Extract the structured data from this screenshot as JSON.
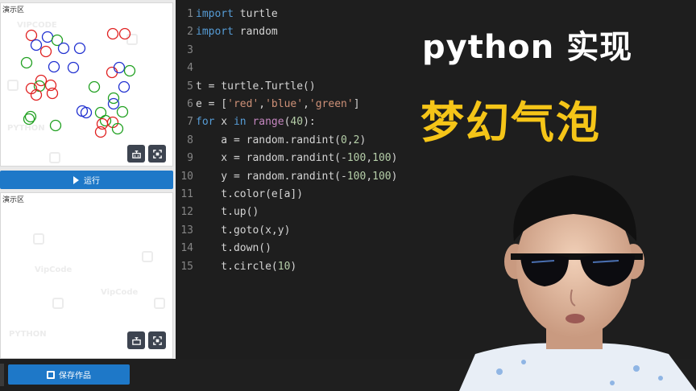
{
  "panels": {
    "top_title": "演示区",
    "bottom_title": "演示区",
    "watermarks": [
      "VIPCODE",
      "PYTHON",
      "VipCode",
      "VipCode",
      "PYTHON"
    ]
  },
  "run_button": {
    "label": "运行"
  },
  "save_button": {
    "label": "保存作品"
  },
  "overlay": {
    "title_line1": "python 实现",
    "title_line2": "梦幻气泡",
    "title1_color": "#ffffff",
    "title2_color": "#f5c518"
  },
  "editor": {
    "lines": [
      {
        "n": "1",
        "tokens": [
          [
            "kw",
            "import"
          ],
          [
            "t",
            " turtle"
          ]
        ]
      },
      {
        "n": "2",
        "tokens": [
          [
            "kw",
            "import"
          ],
          [
            "t",
            " random"
          ]
        ]
      },
      {
        "n": "3",
        "tokens": []
      },
      {
        "n": "4",
        "tokens": []
      },
      {
        "n": "5",
        "tokens": [
          [
            "t",
            "t = turtle.Turtle()"
          ]
        ]
      },
      {
        "n": "6",
        "tokens": [
          [
            "t",
            "e = ["
          ],
          [
            "str",
            "'red'"
          ],
          [
            "t",
            ","
          ],
          [
            "str",
            "'blue'"
          ],
          [
            "t",
            ","
          ],
          [
            "str",
            "'green'"
          ],
          [
            "t",
            "]"
          ]
        ]
      },
      {
        "n": "7",
        "tokens": [
          [
            "kw",
            "for"
          ],
          [
            "t",
            " x "
          ],
          [
            "kw",
            "in"
          ],
          [
            "t",
            " "
          ],
          [
            "bi",
            "range"
          ],
          [
            "t",
            "("
          ],
          [
            "num",
            "40"
          ],
          [
            "t",
            "):"
          ]
        ]
      },
      {
        "n": "8",
        "tokens": [
          [
            "t",
            "    a = random.randint("
          ],
          [
            "num",
            "0"
          ],
          [
            "t",
            ","
          ],
          [
            "num",
            "2"
          ],
          [
            "t",
            ")"
          ]
        ]
      },
      {
        "n": "9",
        "tokens": [
          [
            "t",
            "    x = random.randint(-"
          ],
          [
            "num",
            "100"
          ],
          [
            "t",
            ","
          ],
          [
            "num",
            "100"
          ],
          [
            "t",
            ")"
          ]
        ]
      },
      {
        "n": "10",
        "tokens": [
          [
            "t",
            "    y = random.randint(-"
          ],
          [
            "num",
            "100"
          ],
          [
            "t",
            ","
          ],
          [
            "num",
            "100"
          ],
          [
            "t",
            ")"
          ]
        ]
      },
      {
        "n": "11",
        "tokens": [
          [
            "t",
            "    t.color(e[a])"
          ]
        ]
      },
      {
        "n": "12",
        "tokens": [
          [
            "t",
            "    t.up()"
          ]
        ]
      },
      {
        "n": "13",
        "tokens": [
          [
            "t",
            "    t.goto(x,y)"
          ]
        ]
      },
      {
        "n": "14",
        "tokens": [
          [
            "t",
            "    t.down()"
          ]
        ]
      },
      {
        "n": "15",
        "tokens": [
          [
            "t",
            "    t.circle("
          ],
          [
            "num",
            "10"
          ],
          [
            "t",
            ")"
          ]
        ]
      }
    ]
  },
  "turtle_output": {
    "circle_colors": {
      "red": "#e02020",
      "blue": "#2030d0",
      "green": "#20a020"
    },
    "circles": [
      [
        "red",
        38,
        40
      ],
      [
        "blue",
        58,
        42
      ],
      [
        "blue",
        44,
        52
      ],
      [
        "green",
        70,
        46
      ],
      [
        "red",
        56,
        60
      ],
      [
        "blue",
        78,
        56
      ],
      [
        "blue",
        98,
        56
      ],
      [
        "red",
        139,
        38
      ],
      [
        "red",
        154,
        38
      ],
      [
        "blue",
        66,
        79
      ],
      [
        "green",
        32,
        74
      ],
      [
        "blue",
        90,
        80
      ],
      [
        "red",
        138,
        86
      ],
      [
        "blue",
        147,
        80
      ],
      [
        "green",
        160,
        84
      ],
      [
        "red",
        50,
        96
      ],
      [
        "green",
        48,
        103
      ],
      [
        "red",
        38,
        106
      ],
      [
        "red",
        62,
        102
      ],
      [
        "red",
        44,
        114
      ],
      [
        "red",
        64,
        112
      ],
      [
        "green",
        116,
        104
      ],
      [
        "blue",
        153,
        104
      ],
      [
        "green",
        140,
        118
      ],
      [
        "blue",
        140,
        125
      ],
      [
        "blue",
        101,
        134
      ],
      [
        "blue",
        106,
        136
      ],
      [
        "green",
        124,
        136
      ],
      [
        "green",
        151,
        135
      ],
      [
        "green",
        130,
        146
      ],
      [
        "red",
        126,
        150
      ],
      [
        "green",
        35,
        144
      ],
      [
        "green",
        68,
        152
      ],
      [
        "red",
        139,
        148
      ],
      [
        "green",
        145,
        156
      ],
      [
        "red",
        124,
        160
      ],
      [
        "green",
        37,
        141
      ]
    ]
  }
}
